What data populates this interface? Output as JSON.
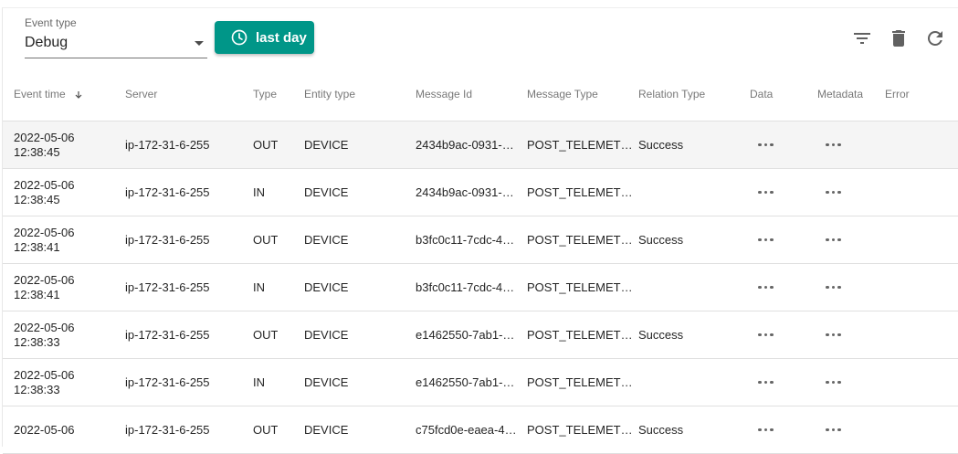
{
  "event_type": {
    "label": "Event type",
    "value": "Debug"
  },
  "time_button": {
    "label": "last day"
  },
  "toolbar": {
    "icons": [
      "filter-icon",
      "delete-icon",
      "refresh-icon"
    ]
  },
  "colors": {
    "accent": "#009688",
    "row_highlight": "#f5f5f5"
  },
  "table": {
    "columns": [
      "Event time",
      "Server",
      "Type",
      "Entity type",
      "Message Id",
      "Message Type",
      "Relation Type",
      "Data",
      "Metadata",
      "Error"
    ],
    "rows": [
      {
        "date": "2022-05-06",
        "time": "12:38:45",
        "server": "ip-172-31-6-255",
        "type": "OUT",
        "entity": "DEVICE",
        "msg_id": "2434b9ac-0931-…",
        "msg_type": "POST_TELEMET…",
        "relation": "Success"
      },
      {
        "date": "2022-05-06",
        "time": "12:38:45",
        "server": "ip-172-31-6-255",
        "type": "IN",
        "entity": "DEVICE",
        "msg_id": "2434b9ac-0931-…",
        "msg_type": "POST_TELEMET…",
        "relation": ""
      },
      {
        "date": "2022-05-06",
        "time": "12:38:41",
        "server": "ip-172-31-6-255",
        "type": "OUT",
        "entity": "DEVICE",
        "msg_id": "b3fc0c11-7cdc-4…",
        "msg_type": "POST_TELEMET…",
        "relation": "Success"
      },
      {
        "date": "2022-05-06",
        "time": "12:38:41",
        "server": "ip-172-31-6-255",
        "type": "IN",
        "entity": "DEVICE",
        "msg_id": "b3fc0c11-7cdc-4…",
        "msg_type": "POST_TELEMET…",
        "relation": ""
      },
      {
        "date": "2022-05-06",
        "time": "12:38:33",
        "server": "ip-172-31-6-255",
        "type": "OUT",
        "entity": "DEVICE",
        "msg_id": "e1462550-7ab1-…",
        "msg_type": "POST_TELEMET…",
        "relation": "Success"
      },
      {
        "date": "2022-05-06",
        "time": "12:38:33",
        "server": "ip-172-31-6-255",
        "type": "IN",
        "entity": "DEVICE",
        "msg_id": "e1462550-7ab1-…",
        "msg_type": "POST_TELEMET…",
        "relation": ""
      },
      {
        "date": "2022-05-06",
        "time": "",
        "server": "ip-172-31-6-255",
        "type": "OUT",
        "entity": "DEVICE",
        "msg_id": "c75fcd0e-eaea-4…",
        "msg_type": "POST_TELEMET…",
        "relation": "Success"
      }
    ]
  }
}
